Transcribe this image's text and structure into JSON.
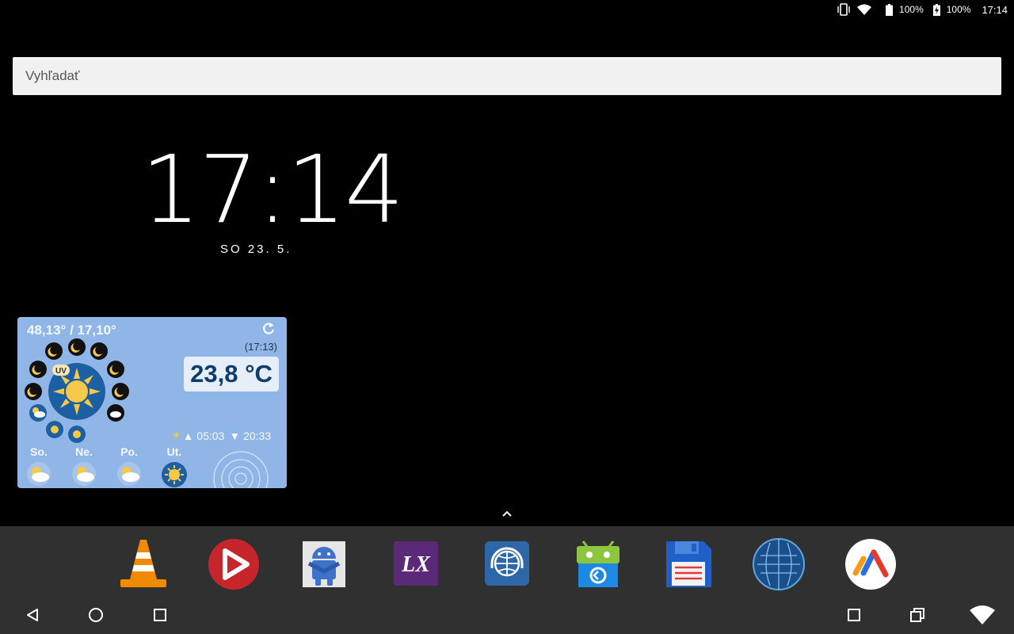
{
  "status_bar": {
    "battery1": "100%",
    "battery2": "100%",
    "time": "17:14",
    "icons": [
      "vibrate-icon",
      "wifi-icon",
      "battery-icon",
      "battery-charging-icon"
    ]
  },
  "search": {
    "placeholder": "Vyhľadať"
  },
  "clock": {
    "time": "17:14",
    "date": "SO 23. 5."
  },
  "weather": {
    "coords": "48,13° / 17,10°",
    "updated": "(17:13)",
    "temperature": "23,8 °C",
    "uv_label": "UV",
    "sunrise": "▲ 05:03",
    "sunset": "▼ 20:33",
    "forecast": [
      {
        "day": "So.",
        "icon": "partly-cloudy-icon"
      },
      {
        "day": "Ne.",
        "icon": "partly-cloudy-icon"
      },
      {
        "day": "Po.",
        "icon": "partly-cloudy-icon"
      },
      {
        "day": "Ut.",
        "icon": "sunny-icon"
      }
    ]
  },
  "dock": {
    "apps": [
      {
        "name": "vlc",
        "icon": "vlc-cone-icon"
      },
      {
        "name": "red-play",
        "icon": "play-icon"
      },
      {
        "name": "android-hug",
        "icon": "android-icon"
      },
      {
        "name": "lx",
        "icon": "lx-icon",
        "label": "LX"
      },
      {
        "name": "web-radio",
        "icon": "globe-headphones-icon"
      },
      {
        "name": "android-green",
        "icon": "android-robot-icon"
      },
      {
        "name": "save",
        "icon": "floppy-icon"
      },
      {
        "name": "globe",
        "icon": "earth-icon"
      },
      {
        "name": "vidtrim",
        "icon": "v-icon"
      }
    ]
  },
  "colors": {
    "dock_bg": "#303030",
    "widget_bg": "#8fb6e6",
    "search_bg": "#f1f1f1"
  }
}
